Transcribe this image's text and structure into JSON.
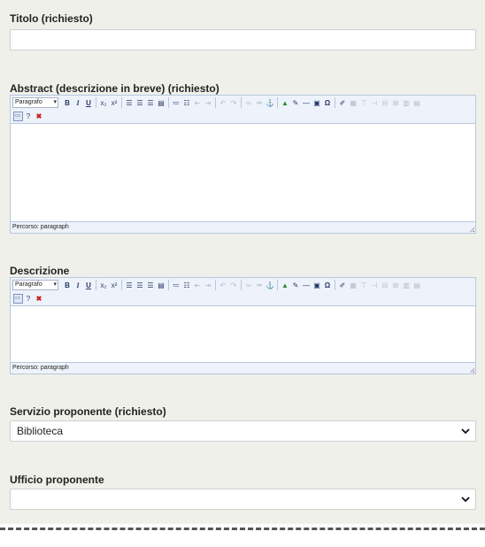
{
  "fields": {
    "title_label": "Titolo (richiesto)",
    "abstract_label": "Abstract (descrizione in breve) (richiesto)",
    "description_label": "Descrizione",
    "service_label": "Servizio proponente (richiesto)",
    "service_value": "Biblioteca",
    "office_label": "Ufficio proponente",
    "office_value": ""
  },
  "editor": {
    "format_value": "Paragrafo",
    "status_text": "Percorso: paragraph",
    "toolbar_icons": [
      "bold-icon",
      "italic-icon",
      "underline-icon",
      "subscript-icon",
      "superscript-icon",
      "align-left-icon",
      "align-center-icon",
      "align-right-icon",
      "align-justify-icon",
      "bullet-list-icon",
      "numbered-list-icon",
      "outdent-icon",
      "indent-icon",
      "undo-icon",
      "redo-icon",
      "link-icon",
      "unlink-icon",
      "anchor-icon",
      "image-icon",
      "cleanup-icon",
      "horizontal-rule-icon",
      "code-icon",
      "special-char-icon",
      "edit-icon",
      "table-icon",
      "table-row-icon",
      "table-col-icon",
      "table-split-icon",
      "table-merge-icon",
      "table-props-icon",
      "table-cell-icon",
      "fullscreen-icon",
      "help-icon",
      "remove-format-icon"
    ]
  },
  "colors": {
    "panel_bg": "#f0f0ea",
    "toolbar_bg": "#eef2fa",
    "editor_border": "#b9c7dc",
    "delete_red": "#c81e1e",
    "insert_green": "#2c8a2c"
  }
}
